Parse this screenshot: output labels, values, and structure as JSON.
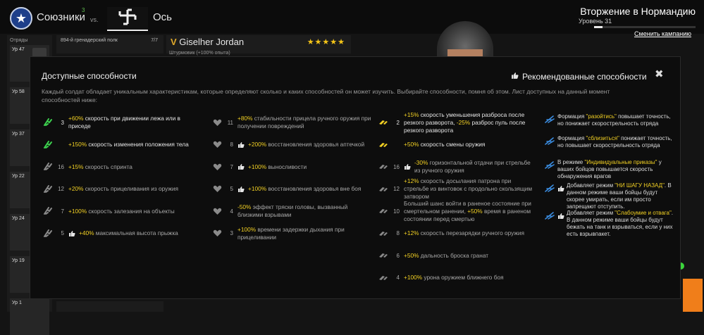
{
  "header": {
    "allies_label": "Союзники",
    "allies_count": "3",
    "vs_label": "vs.",
    "axis_label": "Ось",
    "campaign_title": "Вторжение в Нормандию",
    "campaign_level": "Уровень 31",
    "campaign_progress": 0.08,
    "change_campaign_label": "Сменить кампанию"
  },
  "squads": {
    "label": "Отряды",
    "items": [
      {
        "level": "Ур 47"
      },
      {
        "level": "Ур 58"
      },
      {
        "level": "Ур 37"
      },
      {
        "level": "Ур 22"
      },
      {
        "level": "Ур 24"
      },
      {
        "level": "Ур 19"
      },
      {
        "level": "Ур 1"
      }
    ]
  },
  "regiment": {
    "name": "894-й гренадерский полк",
    "count": "7/7"
  },
  "soldier": {
    "rank": "V",
    "name": "Giselher Jordan",
    "stars": "★★★★★",
    "subtitle": "Штурмовик  (+100% опыта)"
  },
  "modal": {
    "title": "Доступные способности",
    "recommended_title": "Рекомендованные способности",
    "close_label": "✖",
    "description": "Каждый солдат обладает уникальным характеристикам, которые определяют сколько и каких способностей он может изучить. Выбирайте способности, помня об этом. Лист доступных на данный момент способностей ниже:",
    "columns": [
      [
        {
          "num": "3",
          "rec": false,
          "active": true,
          "icon": "run-icon",
          "hl": "+60%",
          "text": " скорость при движении лежа или в приседе"
        },
        {
          "num": "",
          "rec": false,
          "active": true,
          "icon": "run-icon",
          "hl": "+150%",
          "text": " скорость изменения положения тела"
        },
        {
          "num": "16",
          "rec": false,
          "active": false,
          "icon": "run-icon",
          "hl": "+15%",
          "text": " скорость спринта"
        },
        {
          "num": "12",
          "rec": false,
          "active": false,
          "icon": "run-icon",
          "hl": "+20%",
          "text": " скорость прицеливания из оружия"
        },
        {
          "num": "7",
          "rec": false,
          "active": false,
          "icon": "run-icon",
          "hl": "+100%",
          "text": " скорость залезания на объекты"
        },
        {
          "num": "5",
          "rec": true,
          "active": false,
          "icon": "run-icon",
          "hl": "+40%",
          "text": " максимальная высота прыжка"
        }
      ],
      [
        {
          "num": "11",
          "rec": false,
          "active": false,
          "icon": "heart-icon",
          "hl": "+80%",
          "text": " стабильности прицела ручного оружия при получении повреждений"
        },
        {
          "num": "8",
          "rec": true,
          "active": false,
          "icon": "heart-icon",
          "hl": "+200%",
          "text": " восстановления здоровья аптечкой"
        },
        {
          "num": "7",
          "rec": true,
          "active": false,
          "icon": "heart-icon",
          "hl": "+100%",
          "text": " выносливости"
        },
        {
          "num": "5",
          "rec": true,
          "active": false,
          "icon": "heart-icon",
          "hl": "+100%",
          "text": " восстановления здоровья вне боя"
        },
        {
          "num": "4",
          "rec": false,
          "active": false,
          "icon": "heart-icon",
          "hl": "-50%",
          "text": " эффект тряски головы, вызванный близкими взрывами"
        },
        {
          "num": "3",
          "rec": false,
          "active": false,
          "icon": "heart-icon",
          "hl": "+100%",
          "text": " времени задержки дыхания при прицеливании"
        }
      ],
      [
        {
          "num": "2",
          "rec": false,
          "active": true,
          "icon": "ammo-icon",
          "hl": "+15%",
          "text": " скорость уменьшения разброса после резкого разворота, ",
          "hl2": "-25%",
          "text2": " разброс пуль после резкого разворота"
        },
        {
          "num": "",
          "rec": false,
          "active": true,
          "icon": "ammo-icon",
          "hl": "+50%",
          "text": " скорость смены оружия"
        },
        {
          "num": "16",
          "rec": true,
          "active": false,
          "icon": "ammo-icon",
          "hl": "-30%",
          "text": " горизонтальной отдачи при стрельбе из ручного оружия"
        },
        {
          "num": "12",
          "rec": false,
          "active": false,
          "icon": "ammo-icon",
          "hl": "+12%",
          "text": " скорость досылания патрона при стрельбе из винтовок с продольно скользящим затвором"
        },
        {
          "num": "10",
          "rec": false,
          "active": false,
          "icon": "ammo-icon",
          "hl": "",
          "text": "Больший шанс войти в раненое состояние при смертельном ранении, ",
          "hl2": "+50%",
          "text2": " время в раненом состоянии перед смертью"
        },
        {
          "num": "8",
          "rec": false,
          "active": false,
          "icon": "ammo-icon",
          "hl": "+12%",
          "text": " скорость перезарядки ручного оружия"
        },
        {
          "num": "6",
          "rec": false,
          "active": false,
          "icon": "ammo-icon",
          "hl": "+50%",
          "text": " дальность броска гранат"
        },
        {
          "num": "4",
          "rec": false,
          "active": false,
          "icon": "ammo-icon",
          "hl": "+100%",
          "text": " урона оружием ближнего боя"
        }
      ]
    ],
    "recommended": [
      {
        "rec": false,
        "pre": "Формация ",
        "hl": "\"разойтись\"",
        "post": " повышает точность, но понижает скорострельность отряда"
      },
      {
        "rec": false,
        "pre": "Формация ",
        "hl": "\"сблизиться\"",
        "post": " понижает точность, но повышает скорострельность отряда"
      },
      {
        "rec": false,
        "pre": "В режиме ",
        "hl": "\"Индивидуальные приказы\"",
        "post": " у ваших бойцов повышается скорость обнаружения врагов"
      },
      {
        "rec": true,
        "pre": "Добавляет режим ",
        "hl": "\"НИ ШАГУ НАЗАД\"",
        "post": ". В данном режиме ваши бойцы будут скорее умирать, если им просто запрещают отступить."
      },
      {
        "rec": true,
        "pre": "Добавляет режим ",
        "hl": "\"Слабоумие и отвага\"",
        "post": ". В данном режиме ваши бойцы будут бежать на танк и взрываться, если у них есть взрывпакет."
      }
    ]
  }
}
